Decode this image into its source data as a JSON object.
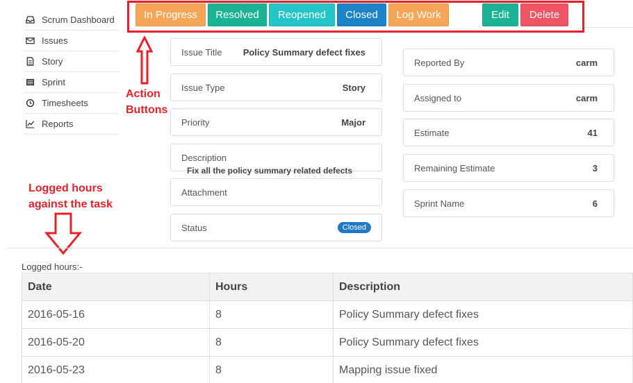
{
  "sidebar": {
    "items": [
      {
        "label": "Scrum Dashboard",
        "icon": "inbox-icon"
      },
      {
        "label": "Issues",
        "icon": "envelope-icon"
      },
      {
        "label": "Story",
        "icon": "document-icon"
      },
      {
        "label": "Sprint",
        "icon": "list-icon"
      },
      {
        "label": "Timesheets",
        "icon": "clock-icon"
      },
      {
        "label": "Reports",
        "icon": "line-chart-icon"
      }
    ]
  },
  "actions": {
    "in_progress": "In Progress",
    "resolved": "Resolved",
    "reopened": "Reopened",
    "closed": "Closed",
    "log_work": "Log Work",
    "edit": "Edit",
    "delete": "Delete"
  },
  "colors": {
    "orange": "#f5a657",
    "green": "#1ab394",
    "teal": "#23c6c8",
    "blue": "#1c84c6",
    "red": "#ed5565",
    "annotation": "#e8202a"
  },
  "annotations": {
    "action_buttons_line1": "Action",
    "action_buttons_line2": "Buttons",
    "logged_line1": "Logged hours",
    "logged_line2": "against the task"
  },
  "issue": {
    "title_label": "Issue Title",
    "title_value": "Policy Summary defect fixes",
    "type_label": "Issue Type",
    "type_value": "Story",
    "priority_label": "Priority",
    "priority_value": "Major",
    "description_label": "Description",
    "description_value": "Fix all the policy summary related defects",
    "attachment_label": "Attachment",
    "status_label": "Status",
    "status_value": "Closed",
    "reported_by_label": "Reported By",
    "reported_by_value": "carm",
    "assigned_to_label": "Assigned to",
    "assigned_to_value": "carm",
    "estimate_label": "Estimate",
    "estimate_value": "41",
    "remaining_label": "Remaining Estimate",
    "remaining_value": "3",
    "sprint_label": "Sprint Name",
    "sprint_value": "6"
  },
  "logged": {
    "title": "Logged hours:-",
    "columns": [
      "Date",
      "Hours",
      "Description"
    ],
    "rows": [
      [
        "2016-05-16",
        "8",
        "Policy Summary defect fixes"
      ],
      [
        "2016-05-20",
        "8",
        "Policy Summary defect fixes"
      ],
      [
        "2016-05-23",
        "8",
        "Mapping issue fixed"
      ]
    ]
  }
}
